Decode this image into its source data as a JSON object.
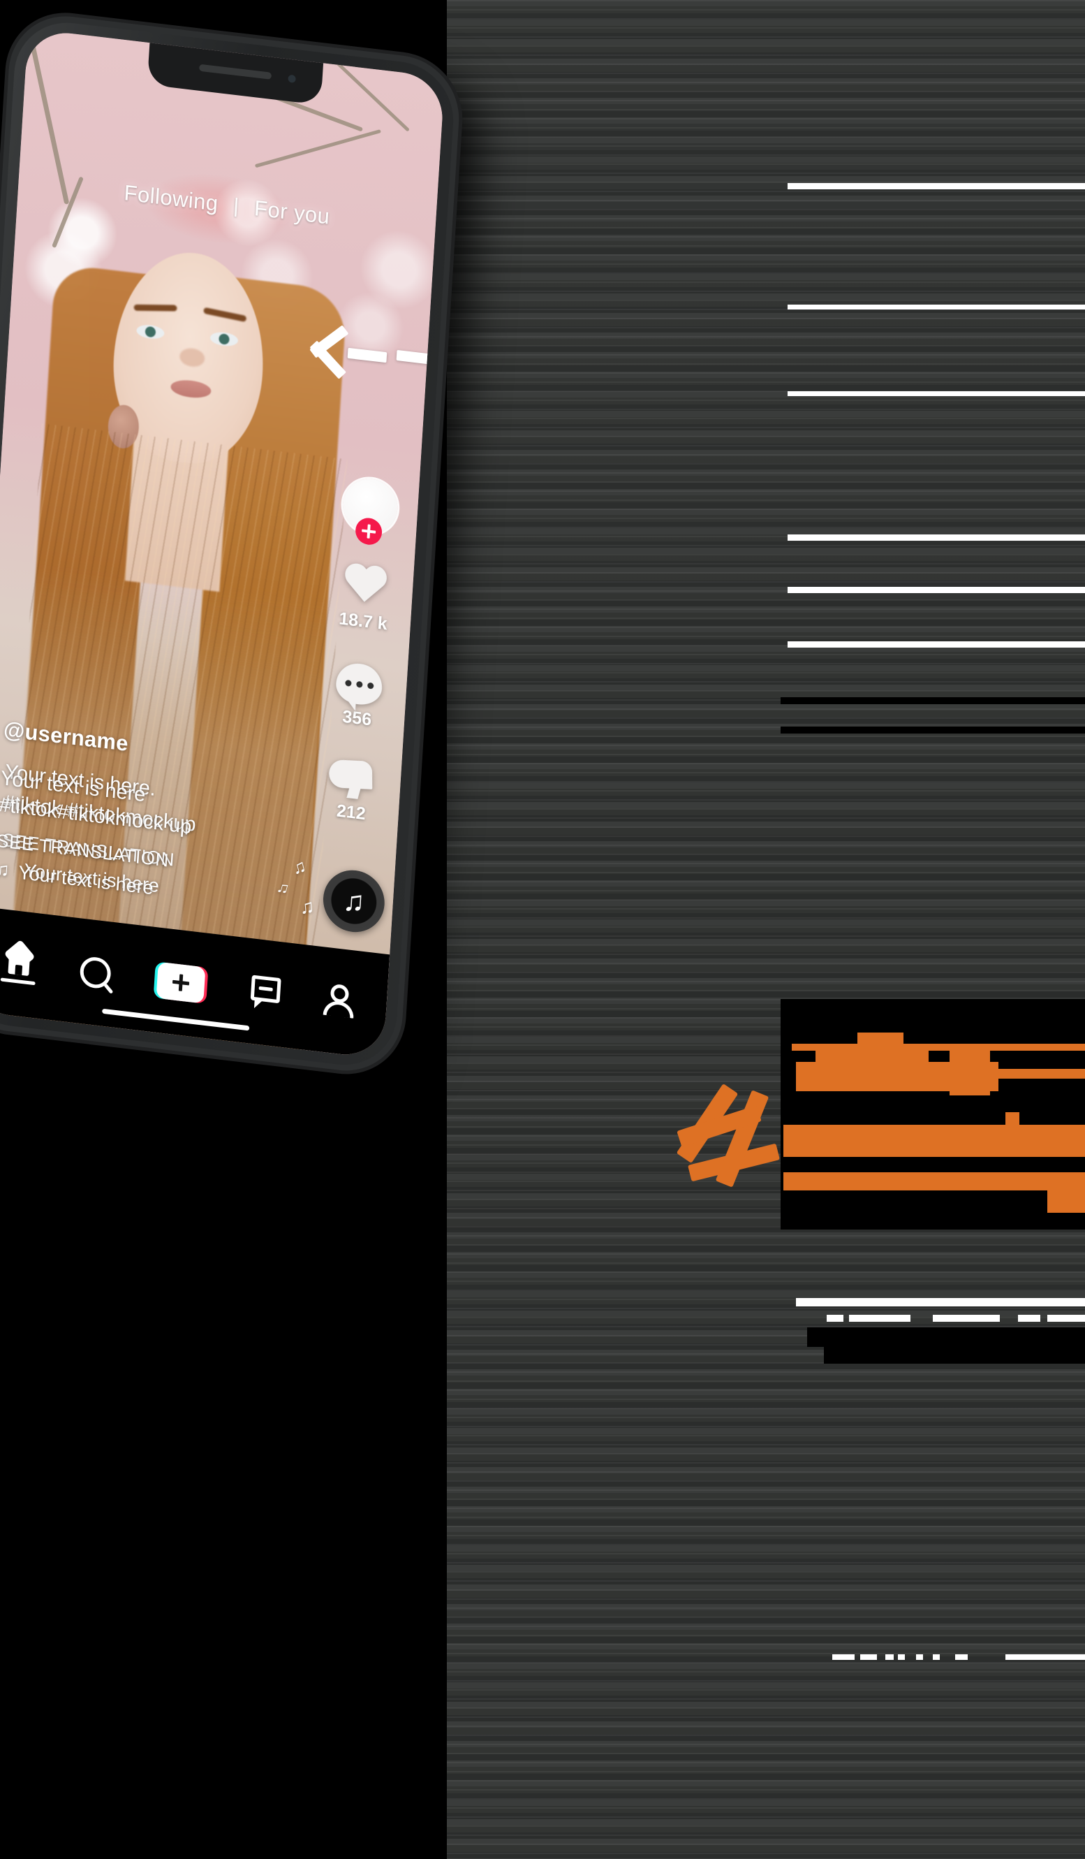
{
  "app": {
    "name": "TikTok",
    "device": "smartphone-mockup"
  },
  "colors": {
    "accent_pink": "#fe2c55",
    "accent_cyan": "#25f4ee",
    "follow_badge": "#f5194b",
    "annotation_orange": "#de7124",
    "screen_bg_pink": "#e3c2c5",
    "nav_bg": "#000000",
    "phone_body": "#2d2f30"
  },
  "feed_header": {
    "tab_following": "Following",
    "separator": "|",
    "tab_for_you": "For you"
  },
  "annotations": {
    "left_arrow": "dashed-left-arrow"
  },
  "action_rail": {
    "avatar": {
      "name": "profile-avatar",
      "follow_badge": "+"
    },
    "like": {
      "icon": "heart-icon",
      "count": "18.7 k"
    },
    "comment": {
      "icon": "comment-bubble-icon",
      "count": "356"
    },
    "share": {
      "icon": "share-arrow-icon",
      "count": "212"
    },
    "music_disc": {
      "icon": "music-note-icon",
      "glyph": "♫"
    }
  },
  "caption": {
    "username": "@username",
    "line_back": "Your text is here.",
    "line_front": "Your text is here",
    "hashtags_back": "#tiktok #tiktokmockup",
    "hashtags_front": "#tiktok#tiktokmock up",
    "see_translation_back": "SEE TRANSLATION",
    "see_translation_front": "SEE TRANSLATION",
    "music_title_back": "Your text is here",
    "music_title_front": "Your text is here",
    "music_glyph": "♫"
  },
  "bottom_nav": {
    "items": [
      {
        "name": "home",
        "icon": "home-icon",
        "active": true
      },
      {
        "name": "discover",
        "icon": "search-icon",
        "active": false
      },
      {
        "name": "create",
        "icon": "plus-icon",
        "active": false
      },
      {
        "name": "inbox",
        "icon": "inbox-icon",
        "active": false
      },
      {
        "name": "profile",
        "icon": "person-icon",
        "active": false
      }
    ]
  },
  "system": {
    "home_indicator": "home-indicator-bar"
  }
}
